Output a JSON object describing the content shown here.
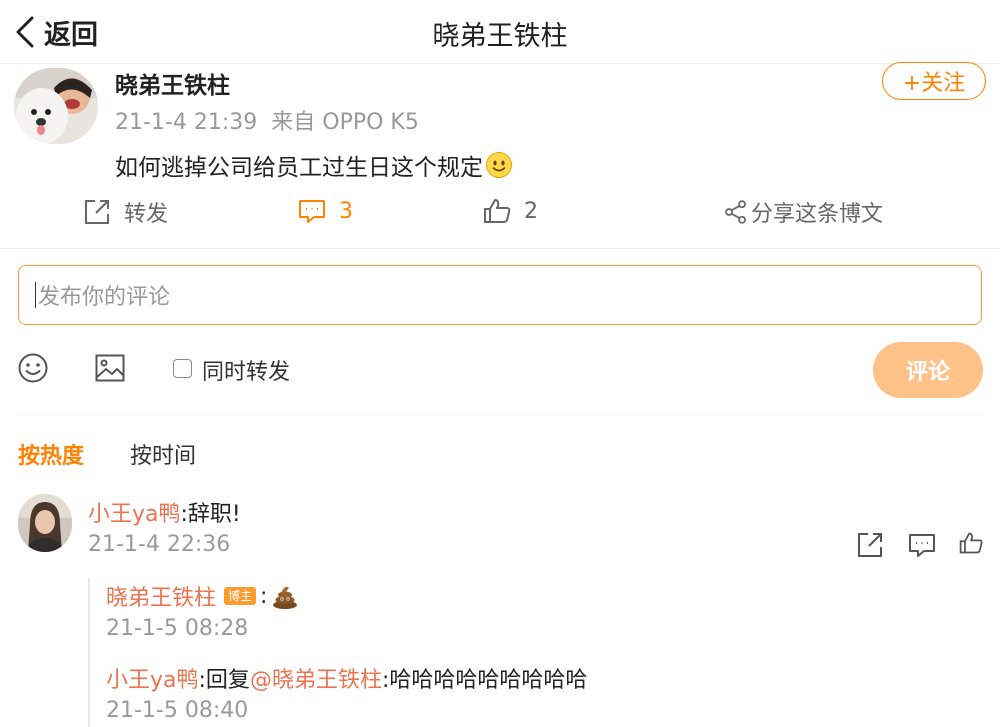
{
  "header": {
    "back_label": "返回",
    "title": "晓弟王铁柱"
  },
  "post": {
    "author": "晓弟王铁柱",
    "time": "21-1-4 21:39",
    "source": "来自 OPPO K5",
    "follow_label": "+关注",
    "content": "如何逃掉公司给员工过生日这个规定",
    "emoji": "smile-emoji",
    "actions": {
      "repost_label": "转发",
      "comment_count": "3",
      "like_count": "2",
      "share_label": "分享这条博文"
    }
  },
  "composer": {
    "placeholder": "发布你的评论",
    "also_repost_label": "同时转发",
    "submit_label": "评论"
  },
  "sort": {
    "hot_label": "按热度",
    "time_label": "按时间"
  },
  "comments": [
    {
      "user": "小王ya鸭",
      "text": ":辞职!",
      "time": "21-1-4 22:36",
      "replies": [
        {
          "user": "晓弟王铁柱",
          "badge": "博主",
          "text": ":",
          "emoji": "poop-emoji",
          "time": "21-1-5 08:28"
        },
        {
          "user": "小王ya鸭",
          "reply_prefix": ":回复",
          "mention": "@晓弟王铁柱",
          "text": ":哈哈哈哈哈哈哈哈哈",
          "time": "21-1-5 08:40"
        }
      ]
    }
  ],
  "colors": {
    "accent": "#ff8200",
    "name_link": "#eb7350",
    "submit_bg": "#ffc38a"
  }
}
